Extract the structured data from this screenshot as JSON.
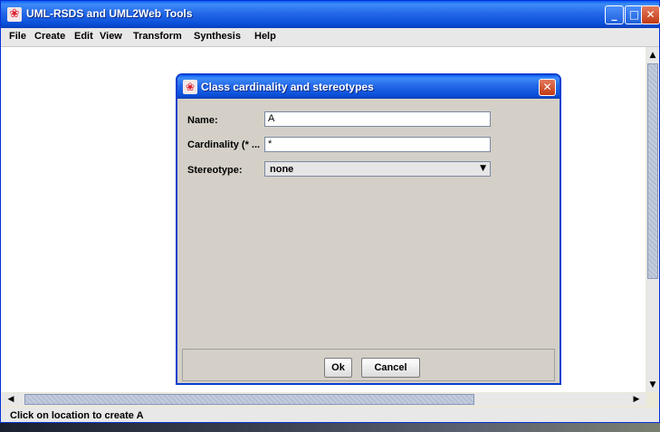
{
  "window": {
    "title": "UML-RSDS and UML2Web Tools",
    "icon": "app-icon",
    "controls": {
      "minimize": "_",
      "maximize": "□",
      "close": "✕"
    }
  },
  "menu": {
    "items": [
      "File",
      "Create",
      "Edit",
      "View",
      "Transform",
      "Synthesis",
      "Help"
    ]
  },
  "dialog": {
    "title": "Class cardinality and stereotypes",
    "close": "✕",
    "fields": {
      "name_label": "Name:",
      "name_value": "A",
      "cardinality_label": "Cardinality (* ...",
      "cardinality_value": "*",
      "stereotype_label": "Stereotype:",
      "stereotype_value": "none"
    },
    "buttons": {
      "ok": "Ok",
      "cancel": "Cancel"
    }
  },
  "scrollbars": {
    "up": "▲",
    "down": "▼",
    "left": "◀",
    "right": "▶"
  },
  "status": "Click on location to create A",
  "colors": {
    "titlebar": "#0a5ff5",
    "close": "#c23a14",
    "dialog_bg": "#d4d0c8"
  }
}
